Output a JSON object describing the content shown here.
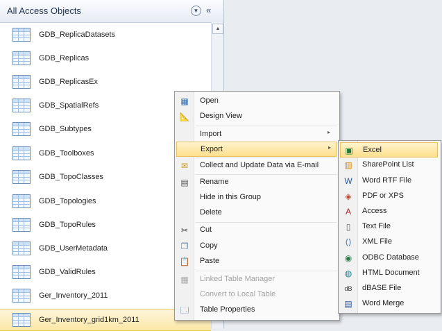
{
  "nav": {
    "title": "All Access Objects",
    "items": [
      {
        "label": "GDB_ReplicaDatasets"
      },
      {
        "label": "GDB_Replicas"
      },
      {
        "label": "GDB_ReplicasEx"
      },
      {
        "label": "GDB_SpatialRefs"
      },
      {
        "label": "GDB_Subtypes"
      },
      {
        "label": "GDB_Toolboxes"
      },
      {
        "label": "GDB_TopoClasses"
      },
      {
        "label": "GDB_Topologies"
      },
      {
        "label": "GDB_TopoRules"
      },
      {
        "label": "GDB_UserMetadata"
      },
      {
        "label": "GDB_ValidRules"
      },
      {
        "label": "Ger_Inventory_2011"
      },
      {
        "label": "Ger_Inventory_grid1km_2011"
      }
    ],
    "selected_index": 12
  },
  "context_menu": {
    "items": [
      {
        "label": "Open",
        "icon": "open-icon"
      },
      {
        "label": "Design View",
        "icon": "design-view-icon"
      },
      {
        "label": "Import",
        "submenu": true
      },
      {
        "label": "Export",
        "submenu": true,
        "highlighted": true
      },
      {
        "label": "Collect and Update Data via E-mail",
        "icon": "email-collect-icon"
      },
      {
        "label": "Rename",
        "icon": "rename-icon"
      },
      {
        "label": "Hide in this Group"
      },
      {
        "label": "Delete"
      },
      {
        "label": "Cut",
        "icon": "cut-icon"
      },
      {
        "label": "Copy",
        "icon": "copy-icon"
      },
      {
        "label": "Paste",
        "icon": "paste-icon"
      },
      {
        "label": "Linked Table Manager",
        "icon": "linked-table-icon",
        "disabled": true
      },
      {
        "label": "Convert to Local Table",
        "disabled": true
      },
      {
        "label": "Table Properties",
        "icon": "table-properties-icon"
      }
    ]
  },
  "export_menu": {
    "items": [
      {
        "label": "Excel",
        "icon": "excel-icon",
        "highlighted": true
      },
      {
        "label": "SharePoint List",
        "icon": "sharepoint-icon"
      },
      {
        "label": "Word RTF File",
        "icon": "word-icon"
      },
      {
        "label": "PDF or XPS",
        "icon": "pdf-icon"
      },
      {
        "label": "Access",
        "icon": "access-icon"
      },
      {
        "label": "Text File",
        "icon": "text-file-icon"
      },
      {
        "label": "XML File",
        "icon": "xml-icon"
      },
      {
        "label": "ODBC Database",
        "icon": "odbc-icon"
      },
      {
        "label": "HTML Document",
        "icon": "html-icon"
      },
      {
        "label": "dBASE File",
        "icon": "dbase-icon"
      },
      {
        "label": "Word Merge",
        "icon": "word-merge-icon"
      }
    ]
  },
  "colors": {
    "highlight": "#fde08d",
    "accent": "#2b579a",
    "menu_border": "#979797"
  }
}
